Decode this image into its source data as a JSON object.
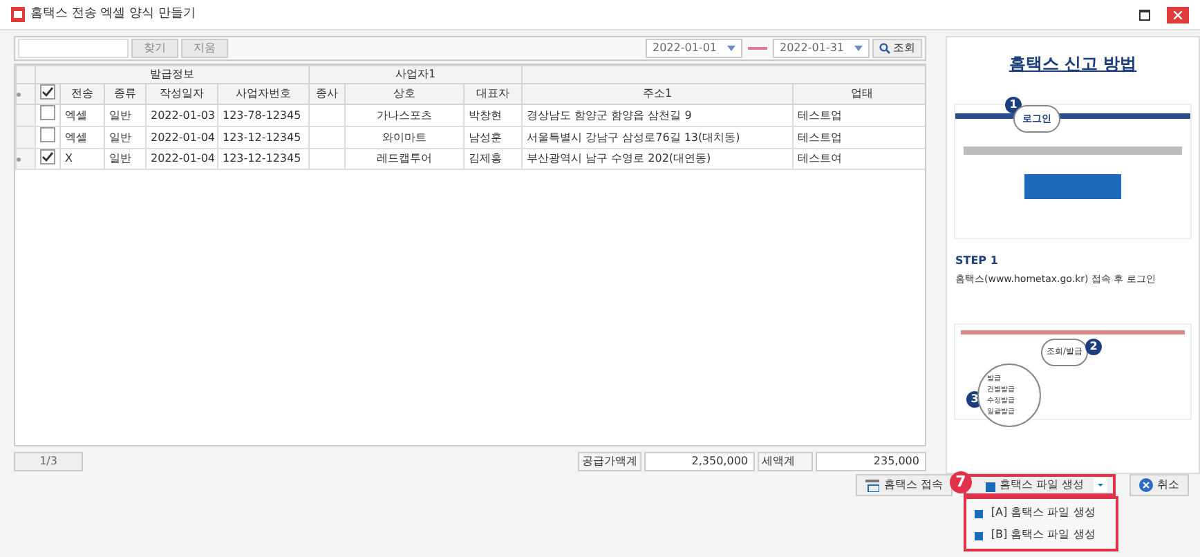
{
  "window": {
    "title": "홈택스 전송 엑셀 양식 만들기"
  },
  "toolbar": {
    "buttons": [
      "찾기",
      "지움"
    ],
    "date_from": "2022-01-01",
    "date_to": "2022-01-31",
    "query_button": "조회"
  },
  "table": {
    "groups": [
      "발급정보",
      "사업자1"
    ],
    "header_checked": true,
    "columns": [
      "전송",
      "종류",
      "작성일자",
      "사업자번호",
      "종사",
      "상호",
      "대표자",
      "주소1",
      "업태"
    ],
    "rows": [
      {
        "current": false,
        "checked": false,
        "cells": [
          "엑셀",
          "일반",
          "2022-01-03",
          "123-78-12345",
          "",
          "가나스포츠",
          "박창현",
          "경상남도 함양군 함양읍 삼천길 9",
          "테스트업"
        ]
      },
      {
        "current": false,
        "checked": false,
        "cells": [
          "엑셀",
          "일반",
          "2022-01-04",
          "123-12-12345",
          "",
          "와이마트",
          "남성훈",
          "서울특별시 강남구 삼성로76길 13(대치동)",
          "테스트업"
        ]
      },
      {
        "current": true,
        "checked": true,
        "cells": [
          "X",
          "일반",
          "2022-01-04",
          "123-12-12345",
          "",
          "레드캡투어",
          "김제홍",
          "부산광역시 남구 수영로 202(대연동)",
          "테스트여"
        ]
      }
    ]
  },
  "footer": {
    "page": "1/3",
    "supply_label": "공급가액계",
    "supply_value": "2,350,000",
    "tax_label": "세액계",
    "tax_value": "235,000"
  },
  "actions": {
    "connect": "홈택스 접속",
    "generate": "홈택스 파일 생성",
    "cancel": "취소",
    "badge": "7",
    "menu": [
      "[A] 홈택스 파일 생성",
      "[B] 홈택스 파일 생성"
    ]
  },
  "guide": {
    "title": "홈택스 신고 방법",
    "shot1_badge": "1",
    "shot1_callout": "로그인",
    "step": "STEP 1",
    "step_text": "홈택스(www.hometax.go.kr) 접속 후 로그인",
    "shot2_badge2": "2",
    "shot2_callout2": "조회/발급",
    "shot2_badge3": "3",
    "shot2_menu": [
      "발급",
      "건별발급",
      "수정발급",
      "일괄발급"
    ]
  }
}
